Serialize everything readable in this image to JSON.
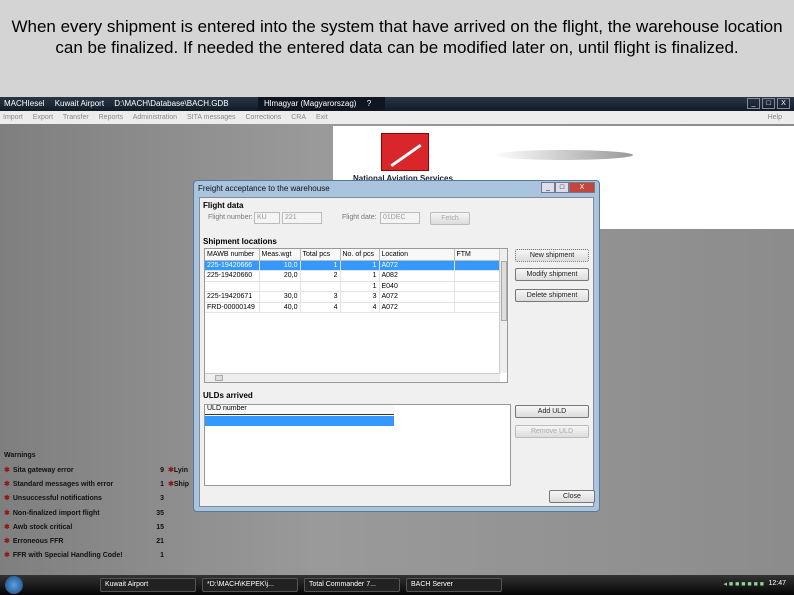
{
  "caption": "When every shipment is entered into the system that have arrived on the flight, the warehouse location can be finalized. If needed the entered data can be modified later on, until flight is finalized.",
  "app": {
    "title": "MACHIesel",
    "airport": "Kuwait Airport",
    "path": "D:\\MACH\\Database\\BACH.GDB",
    "user": "Hlmagyar (Magyarorszag)",
    "help": "Help",
    "menu": [
      "Import",
      "Export",
      "Transfer",
      "Reports",
      "Administration",
      "SITA messages",
      "Corrections",
      "CRA",
      "Exit"
    ]
  },
  "logo": {
    "text": "National Aviation Services"
  },
  "warnings": {
    "title": "Warnings",
    "items": [
      {
        "label": "Sita gateway error",
        "count": "9"
      },
      {
        "label": "Standard messages with error",
        "count": "1"
      },
      {
        "label": "Unsuccessful notifications",
        "count": "3"
      },
      {
        "label": "Non-finalized import flight",
        "count": "35"
      },
      {
        "label": "Awb stock critical",
        "count": "15"
      },
      {
        "label": "Erroneous FFR",
        "count": "21"
      },
      {
        "label": "FFR with Special Handling Code!",
        "count": "1"
      }
    ],
    "items2": [
      "Lyin",
      "Ship"
    ]
  },
  "dialog": {
    "title": "Freight acceptance to the warehouse",
    "flight_data": "Flight data",
    "flight_number_label": "Flight number:",
    "flight_carrier": "KU",
    "flight_no": "221",
    "flight_date_label": "Flight date:",
    "flight_date": "01DEC",
    "fetch": "Fetch",
    "shipment_locations": "Shipment locations",
    "columns": [
      "MAWB number",
      "Meas.wgt",
      "Total pcs",
      "No. of pcs",
      "Location",
      "FTM"
    ],
    "rows": [
      [
        "225-19420666",
        "10,0",
        "1",
        "1",
        "A072",
        ""
      ],
      [
        "225-19420660",
        "20,0",
        "2",
        "1",
        "A082",
        ""
      ],
      [
        "",
        "",
        "",
        "1",
        "E040",
        ""
      ],
      [
        "225-19420671",
        "30,0",
        "3",
        "3",
        "A072",
        ""
      ],
      [
        "FRD-00000149",
        "40,0",
        "4",
        "4",
        "A072",
        ""
      ]
    ],
    "new_shipment": "New shipment",
    "modify_shipment": "Modify shipment",
    "delete_shipment": "Delete shipment",
    "ulds_arrived": "ULDs arrived",
    "uld_column": "ULD number",
    "add_uld": "Add ULD",
    "remove_uld": "Remove ULD",
    "close": "Close"
  },
  "taskbar": {
    "tasks": [
      "Kuwait Airport",
      "*D:\\MACH\\KEPEK\\j...",
      "Total Commander 7...",
      "BACH Server"
    ],
    "clock": "12:47"
  }
}
